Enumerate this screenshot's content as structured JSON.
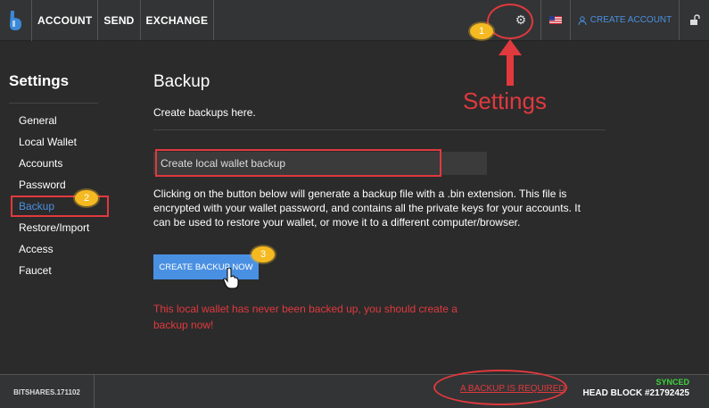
{
  "nav": {
    "items": [
      "ACCOUNT",
      "SEND",
      "EXCHANGE"
    ],
    "create_account": "CREATE ACCOUNT"
  },
  "sidebar": {
    "title": "Settings",
    "items": [
      "General",
      "Local Wallet",
      "Accounts",
      "Password",
      "Backup",
      "Restore/Import",
      "Access",
      "Faucet"
    ],
    "active": "Backup"
  },
  "main": {
    "title": "Backup",
    "subtitle": "Create backups here.",
    "input_value": "Create local wallet backup",
    "description": "Clicking on the button below will generate a backup file with a .bin extension. This file is encrypted with your wallet password, and contains all the private keys for your accounts. It can be used to restore your wallet, or move it to a different computer/browser.",
    "button_label": "CREATE BACKUP NOW",
    "warning": "This local wallet has never been backed up, you should create a backup now!"
  },
  "footer": {
    "version": "BITSHARES.171102",
    "backup_required": "A BACKUP IS REQUIRED",
    "synced": "SYNCED",
    "head_block": "HEAD BLOCK #21792425"
  },
  "annotations": {
    "badge1": "1",
    "badge2": "2",
    "badge3": "3",
    "callout": "Settings"
  },
  "colors": {
    "accent": "#4a90e2",
    "alert": "#e0393e",
    "synced": "#3fd13f",
    "badge": "#f5b921"
  },
  "icons": [
    "bitshares-logo-icon",
    "gear-icon",
    "us-flag-icon",
    "user-icon",
    "unlock-icon",
    "hand-cursor-icon"
  ]
}
